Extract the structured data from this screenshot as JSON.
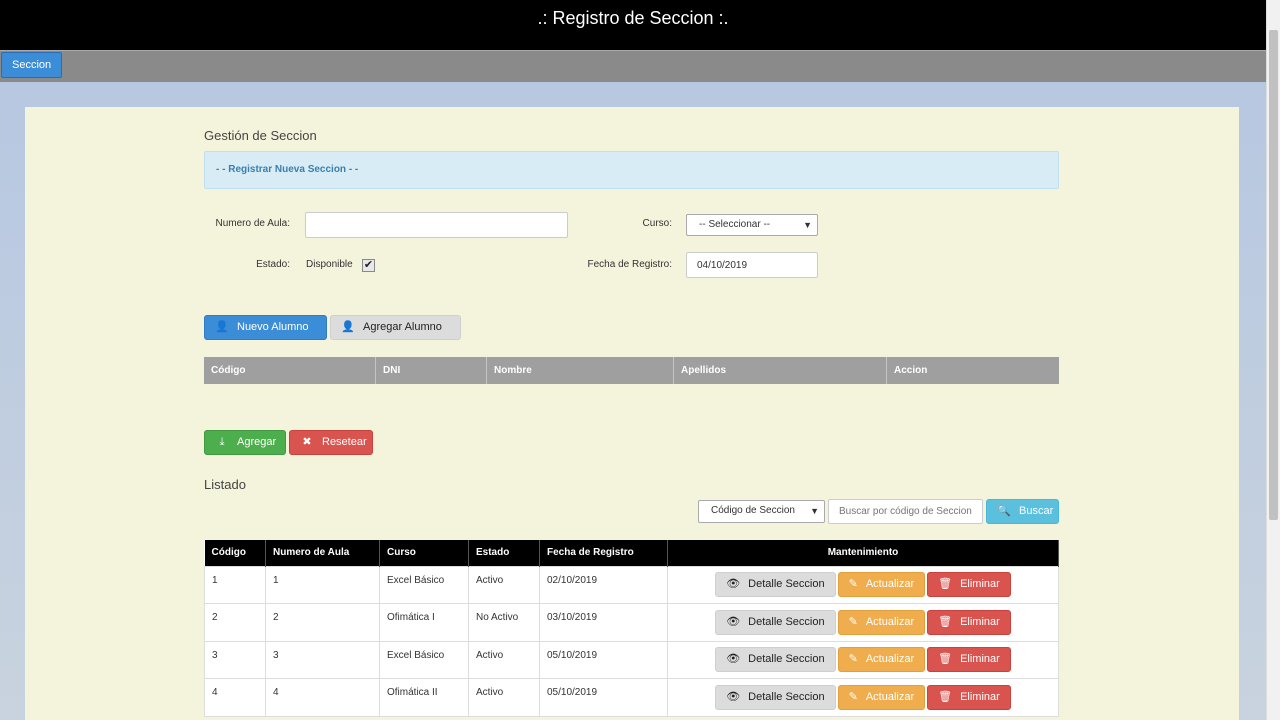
{
  "app": {
    "title": ".: Registro de Seccion :."
  },
  "menu": {
    "tab_label": "Seccion"
  },
  "form": {
    "heading": "Gestión de Seccion",
    "banner": "- - Registrar Nueva Seccion - -",
    "aula_label": "Numero de Aula:",
    "aula_value": "",
    "curso_label": "Curso:",
    "curso_selected": "-- Seleccionar --",
    "estado_label": "Estado:",
    "estado_option": "Disponible",
    "fecha_label": "Fecha de Registro:",
    "fecha_value": "04/10/2019"
  },
  "students": {
    "new_button": "Nuevo   Alumno",
    "add_button": "Agregar   Alumno",
    "columns": [
      "Código",
      "DNI",
      "Nombre",
      "Apellidos",
      "Accion"
    ]
  },
  "form_actions": {
    "add_label": "Agregar",
    "reset_label": "Resetear"
  },
  "listing": {
    "heading": "Listado",
    "filter_selected": "Código de Seccion",
    "search_placeholder": "Buscar por código de Seccion",
    "search_button": "Buscar",
    "columns": [
      "Código",
      "Numero de Aula",
      "Curso",
      "Estado",
      "Fecha de Registro",
      "Mantenimiento"
    ],
    "rows": [
      {
        "codigo": "1",
        "aula": "1",
        "curso": "Excel Básico",
        "estado": "Activo",
        "fecha": "02/10/2019"
      },
      {
        "codigo": "2",
        "aula": "2",
        "curso": "Ofimática I",
        "estado": "No Activo",
        "fecha": "03/10/2019"
      },
      {
        "codigo": "3",
        "aula": "3",
        "curso": "Excel Básico",
        "estado": "Activo",
        "fecha": "05/10/2019"
      },
      {
        "codigo": "4",
        "aula": "4",
        "curso": "Ofimática II",
        "estado": "Activo",
        "fecha": "05/10/2019"
      }
    ],
    "detail_label": "Detalle   Seccion",
    "update_label": "Actualizar",
    "delete_label": "Eliminar"
  },
  "colors": {
    "primary": "#3c8dd8",
    "success": "#4cae4c",
    "danger": "#d9534f",
    "warning": "#f0ad4e",
    "info": "#5bc0de",
    "panel": "#f4f4dc"
  }
}
